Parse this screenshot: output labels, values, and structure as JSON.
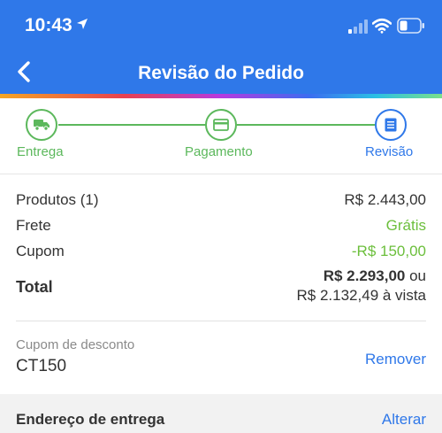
{
  "status_bar": {
    "time": "10:43"
  },
  "nav": {
    "title": "Revisão do Pedido"
  },
  "stepper": {
    "steps": [
      {
        "label": "Entrega",
        "icon": "truck-icon",
        "state": "done"
      },
      {
        "label": "Pagamento",
        "icon": "credit-card-icon",
        "state": "done"
      },
      {
        "label": "Revisão",
        "icon": "document-icon",
        "state": "active"
      }
    ],
    "colors": {
      "done": "#5cb85c",
      "active": "#2f78e9"
    }
  },
  "summary": {
    "products_label": "Produtos (1)",
    "products_value": "R$ 2.443,00",
    "shipping_label": "Frete",
    "shipping_value": "Grátis",
    "coupon_label": "Cupom",
    "coupon_value": "-R$ 150,00",
    "total_label": "Total",
    "total_value": "R$ 2.293,00",
    "total_or": " ou",
    "total_cash": "R$ 2.132,49 à vista"
  },
  "coupon": {
    "title": "Cupom de desconto",
    "code": "CT150",
    "remove_label": "Remover"
  },
  "address": {
    "title": "Endereço de entrega",
    "change_label": "Alterar"
  },
  "colors": {
    "brand": "#2f78e9",
    "success": "#6cbf3c"
  }
}
